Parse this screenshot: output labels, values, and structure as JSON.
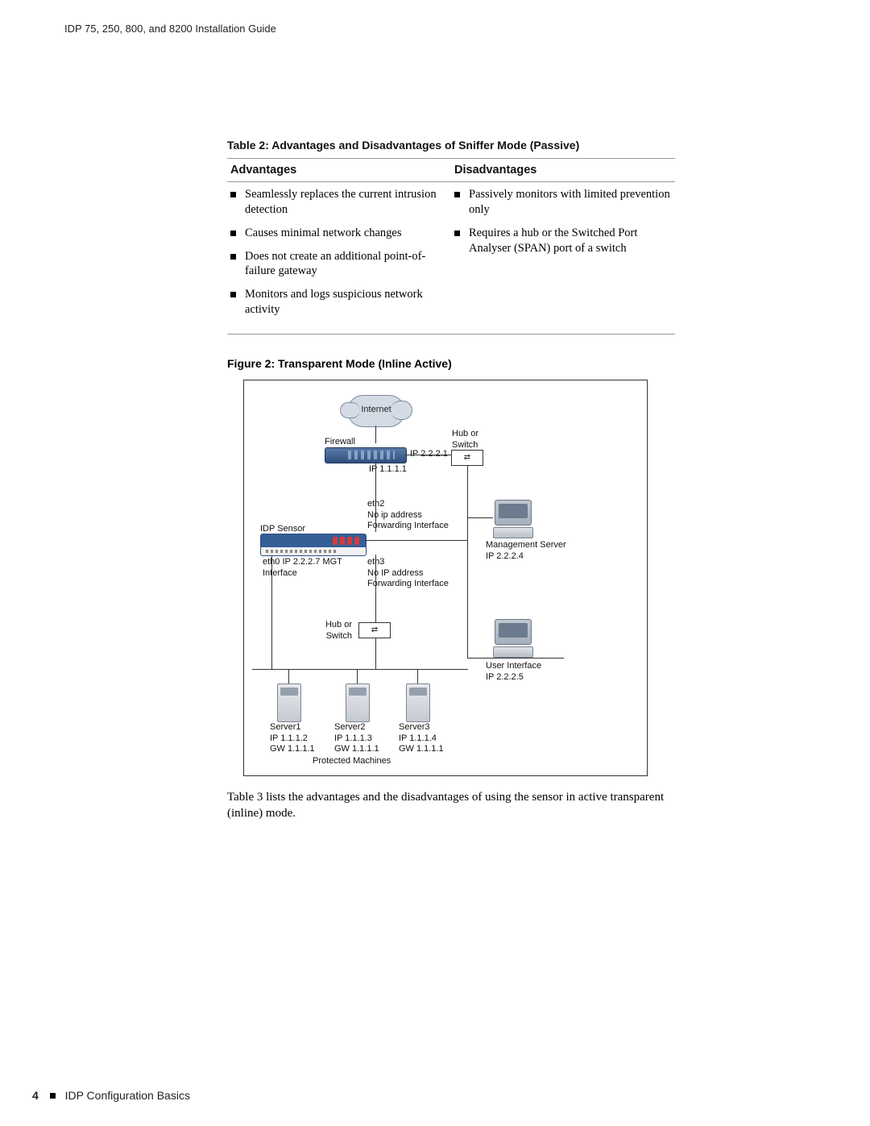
{
  "header": {
    "doc_title": "IDP 75, 250, 800, and 8200 Installation Guide"
  },
  "table2": {
    "caption": "Table 2:  Advantages and Disadvantages of Sniffer Mode (Passive)",
    "head_adv": "Advantages",
    "head_dis": "Disadvantages",
    "adv": [
      "Seamlessly replaces the current intrusion detection",
      "Causes minimal network changes",
      "Does not create an additional point-of-failure gateway",
      "Monitors and logs suspicious network activity"
    ],
    "dis": [
      "Passively monitors with limited prevention only",
      "Requires a hub or the Switched Port Analyser (SPAN) port of a switch"
    ]
  },
  "figure2": {
    "caption": "Figure 2:  Transparent Mode (Inline Active)",
    "labels": {
      "internet": "Internet",
      "firewall": "Firewall",
      "firewall_ip": "IP 2.2.2.1",
      "ip_below_fw": "IP 1.1.1.1",
      "hub_top": "Hub or\nSwitch",
      "eth2": "eth2\nNo ip address\nForwarding Interface",
      "idp_sensor": "IDP Sensor",
      "eth0": "eth0 IP 2.2.2.7 MGT\nInterface",
      "eth3": "eth3\nNo IP address\nForwarding Interface",
      "mgmt": "Management Server\nIP 2.2.2.4",
      "hub_bottom": "Hub or\nSwitch",
      "ui": "User Interface\nIP 2.2.2.5",
      "server1": "Server1\nIP 1.1.1.2\nGW 1.1.1.1",
      "server2": "Server2\nIP 1.1.1.3\nGW 1.1.1.1",
      "server3": "Server3\nIP 1.1.1.4\nGW 1.1.1.1",
      "protected": "Protected Machines"
    }
  },
  "body_para": "Table 3 lists the advantages and the disadvantages of using the sensor in active transparent (inline) mode.",
  "footer": {
    "page": "4",
    "section": "IDP Configuration Basics"
  }
}
